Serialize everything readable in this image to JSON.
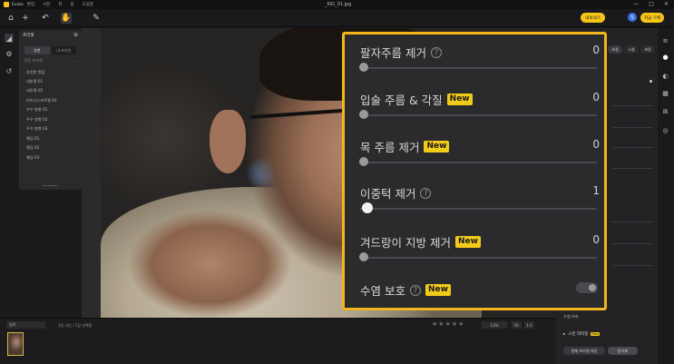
{
  "titlebar": {
    "app_name": "Evoto",
    "menu": [
      "편집",
      "사진",
      "뷰",
      "창",
      "도움말"
    ],
    "file_name": "_KIG_01.jpg",
    "window_buttons": [
      "—",
      "□",
      "✕"
    ]
  },
  "toolbar": {
    "export_label": "내보내기",
    "buy_label": "지금 구매",
    "avatar_letter": "S"
  },
  "presets_panel": {
    "title": "프리셋",
    "tabs": [
      "추천",
      "내 프리셋"
    ],
    "filter_label": "모든 프리셋",
    "items": [
      "추천한 편집",
      "내추럴 01",
      "내추럴 02",
      "비즈니스프로필 01",
      "우수 방향 01",
      "우수 방향 02",
      "우수 방향 03",
      "웨딩 01",
      "웨딩 02",
      "웨딩 03"
    ]
  },
  "overlay": {
    "rows": [
      {
        "label": "팔자주름 제거",
        "value": "0",
        "info": true,
        "badge": "",
        "slider": 0
      },
      {
        "label": "입술 주름 & 각질",
        "value": "0",
        "info": false,
        "badge": "New",
        "slider": 0
      },
      {
        "label": "목 주름 제거",
        "value": "0",
        "info": false,
        "badge": "New",
        "slider": 0
      },
      {
        "label": "이중턱 제거",
        "value": "1",
        "info": true,
        "badge": "",
        "slider": 1
      },
      {
        "label": "겨드랑이 지방 제거",
        "value": "0",
        "info": false,
        "badge": "New",
        "slider": 0
      },
      {
        "label": "수염 보호",
        "value": "",
        "info": true,
        "badge": "New",
        "toggle": false
      }
    ],
    "accent_color": "#f2b51d",
    "badge_color": "#f2cb1a"
  },
  "right_panel": {
    "tabs": [
      "조정",
      "노멀",
      "보정"
    ],
    "skin_retouch_label": "스킨 리터칭",
    "skin_badge": "New",
    "beard_label": "수염 보호",
    "save_preset_label": "현재 프리셋 저장",
    "sync_label": "동기화"
  },
  "bottom_bar": {
    "sort_label": "업로",
    "count_text": "1장 사진 / 1장 선택됨",
    "stars": "★★★★★",
    "zoom_value": "13%",
    "fit_labels": [
      "Fit",
      "1:1"
    ]
  },
  "icons": {
    "home": "⌂",
    "add": "+",
    "undo": "↶",
    "hand": "✋",
    "brush": "✎",
    "info": "?",
    "gear": "⚙",
    "history": "↺",
    "camera": "◎"
  }
}
